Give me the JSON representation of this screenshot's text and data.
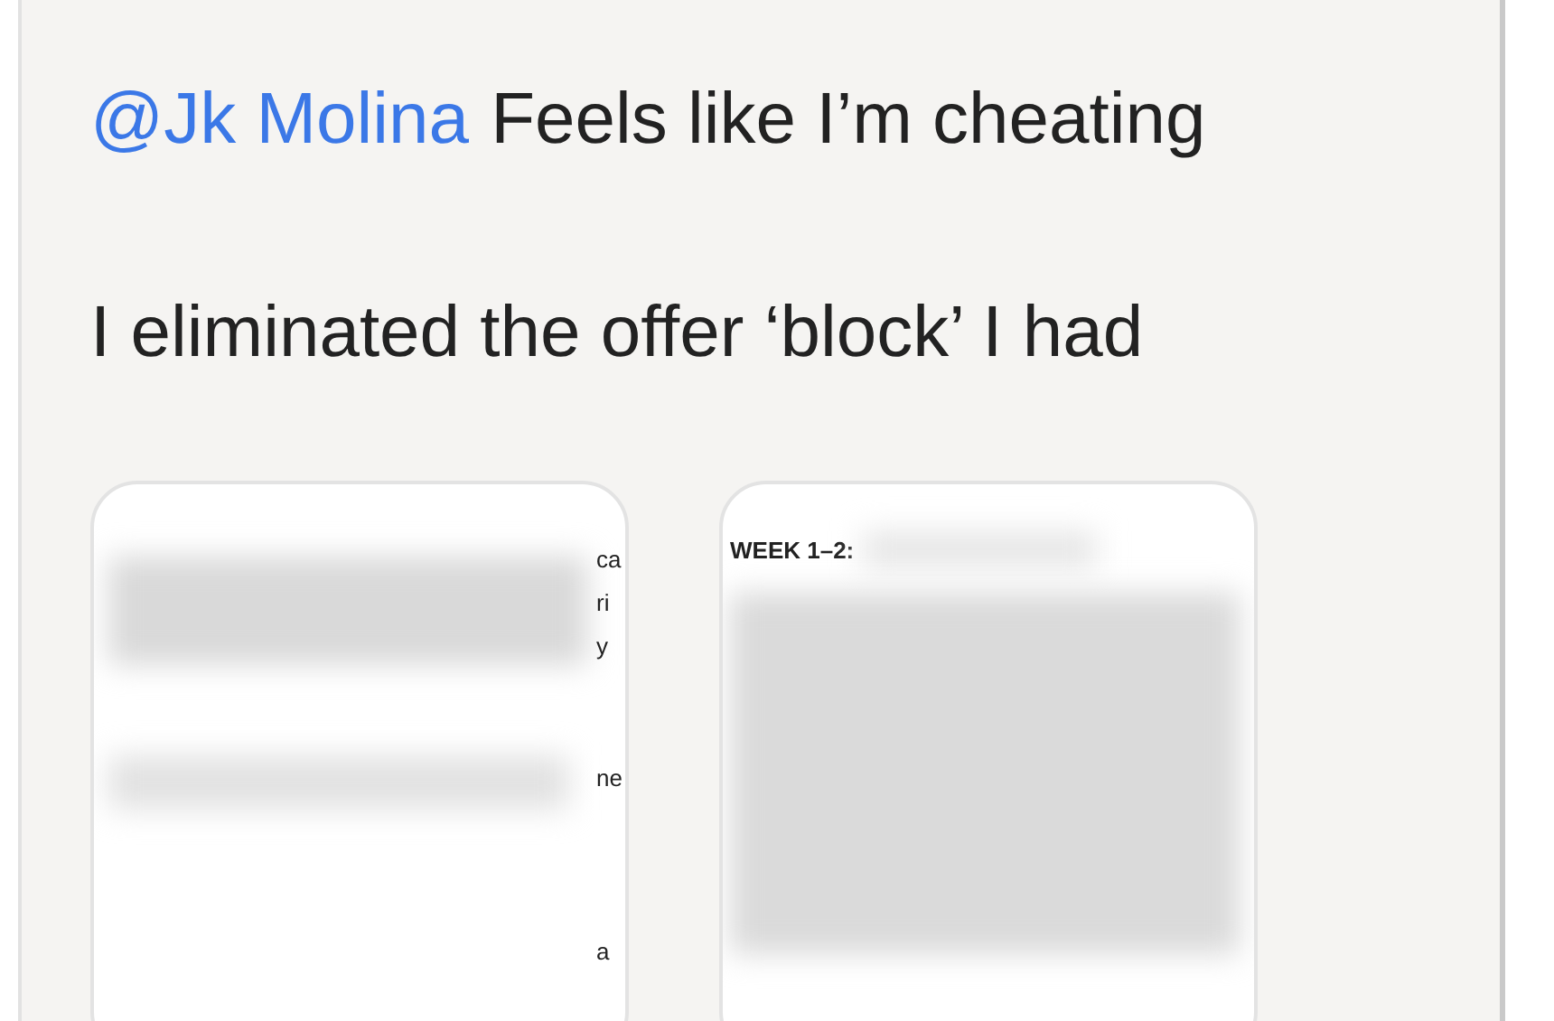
{
  "message": {
    "mention": "@Jk Molina",
    "text": "Feels like I’m cheating",
    "paragraph": "I eliminated the offer ‘block’ I had"
  },
  "attachments": [
    {
      "kind": "cropped",
      "fragments": [
        "ca",
        "ri",
        "y",
        "ne",
        "a"
      ]
    },
    {
      "kind": "heading",
      "heading": "WEEK 1–2:"
    }
  ]
}
